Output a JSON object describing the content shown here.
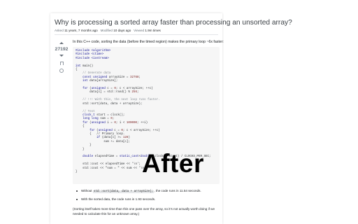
{
  "question": {
    "title": "Why is processing a sorted array faster than processing an unsorted array?",
    "meta": {
      "asked_label": "Asked",
      "asked_value": "11 years, 7 months ago",
      "modified_label": "Modified",
      "modified_value": "10 days ago",
      "viewed_label": "Viewed",
      "viewed_value": "1.9m times"
    }
  },
  "vote": {
    "count": "27192"
  },
  "post": {
    "intro": "In this C++ code, sorting the data (before the timed region) makes the primary loop ~6x faster:",
    "code_lines": [
      "#include <algorithm>",
      "#include <ctime>",
      "#include <iostream>",
      "",
      "int main()",
      "{",
      "    // Generate data",
      "    const unsigned arraySize = 32768;",
      "    int data[arraySize];",
      "",
      "    for (unsigned c = 0; c < arraySize; ++c)",
      "        data[c] = std::rand() % 256;",
      "",
      "    // !!! With this, the next loop runs faster.",
      "    std::sort(data, data + arraySize);",
      "",
      "    // Test",
      "    clock_t start = clock();",
      "    long long sum = 0;",
      "    for (unsigned i = 0; i < 100000; ++i)",
      "    {",
      "        for (unsigned c = 0; c < arraySize; ++c)",
      "        {   // Primary loop.",
      "            if (data[c] >= 128)",
      "                sum += data[c];",
      "        }",
      "    }",
      "",
      "    double elapsedTime = static_cast<double>(clock()-start) / CLOCKS_PER_SEC;",
      "",
      "    std::cout << elapsedTime << '\\n';",
      "    std::cout << \"sum = \" << sum << '\\n';",
      "}"
    ],
    "bullet1_pre": "Without ",
    "bullet1_code": "std::sort(data, data + arraySize);",
    "bullet1_post": ", the code runs in 11.54 seconds.",
    "bullet2": "With the sorted data, the code runs in 1.93 seconds.",
    "note": "(Sorting itself takes more time than this one pass over the array, so it's not actually worth doing if we needed to calculate this for an unknown array.)"
  },
  "overlay": {
    "text": "After"
  }
}
